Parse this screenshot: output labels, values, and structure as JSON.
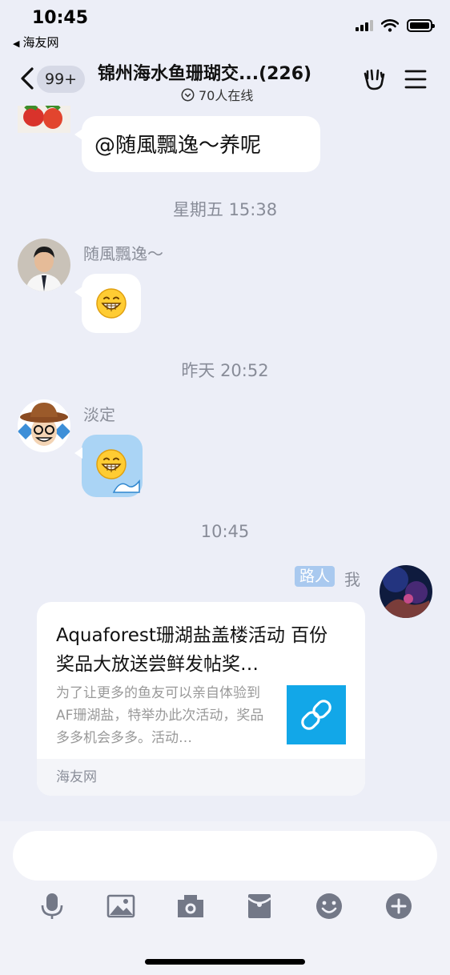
{
  "status_bar": {
    "time": "10:45",
    "back_app_label": "海友网"
  },
  "nav": {
    "unread_count": "99+",
    "title": "锦州海水鱼珊瑚交...(226)",
    "online_text": "70人在线",
    "icons": [
      "back-chevron-icon",
      "hand-gesture-icon",
      "menu-icon"
    ]
  },
  "messages": {
    "m0_text": "@随風飄逸～养呢",
    "ts1": "星期五 15:38",
    "m1_sender": "随風飄逸～",
    "ts2": "昨天 20:52",
    "m2_sender": "淡定",
    "ts3": "10:45",
    "m3_badge": "路人",
    "m3_sender": "我"
  },
  "link_card": {
    "title": "Aquaforest珊湖盐盖楼活动 百份奖品大放送尝鲜发帖奖…",
    "description": "为了让更多的鱼友可以亲自体验到AF珊湖盐，特举办此次活动，奖品多多机会多多。活动…",
    "source": "海友网",
    "thumb_icon": "link-icon"
  },
  "input": {
    "placeholder": ""
  },
  "toolbar_icons": [
    "microphone-icon",
    "image-icon",
    "camera-icon",
    "red-packet-icon",
    "emoji-icon",
    "plus-icon"
  ],
  "colors": {
    "background": "#eceef7",
    "link_thumb": "#12a7e8",
    "badge": "#a9c9ef"
  }
}
